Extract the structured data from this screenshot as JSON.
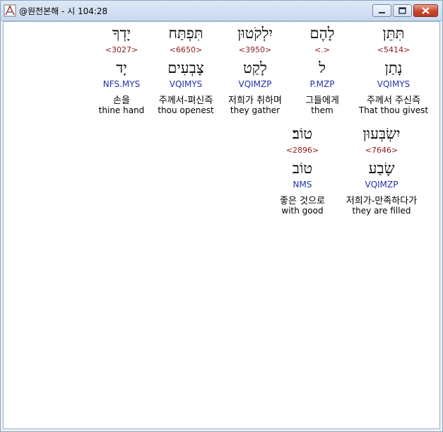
{
  "window": {
    "title": "@원전본해 - 시 104:28",
    "icon": "app-compass-icon",
    "controls": [
      "minimize-icon",
      "maximize-icon",
      "close-icon"
    ],
    "close_color": "#c9462c"
  },
  "colors": {
    "strong": "#8b1a1a",
    "morph": "#2233aa",
    "highlight_bg": "#ffffff",
    "content_bg": "#ffffff"
  },
  "words": [
    {
      "heb": "תִּתֵּן",
      "strong": "<5414>",
      "lemma": "נָתַן",
      "morph": "VQIMYS",
      "kor": "주께서 주신즉",
      "eng": "That thou givest",
      "highlighted": true
    },
    {
      "heb": "לָהֶם",
      "strong": "<.>",
      "lemma": "ל",
      "morph": "P.MZP",
      "kor": "그들에게",
      "eng": "them",
      "highlighted": false
    },
    {
      "heb": "יִלְקֹטוּן",
      "strong": "<3950>",
      "lemma": "לָקַט",
      "morph": "VQIMZP",
      "kor": "저희가 취하며",
      "eng": "they gather",
      "highlighted": false
    },
    {
      "heb": "תִּפְתַּח",
      "strong": "<6650>",
      "lemma": "צָבְעִים",
      "morph": "VQIMYS",
      "kor": "주께서-펴신즉",
      "eng": "thou openest",
      "highlighted": false
    },
    {
      "heb": "יָדְךָ",
      "strong": "<3027>",
      "lemma": "יָד",
      "morph": "NFS.MYS",
      "kor": "손을",
      "eng": "thine hand",
      "highlighted": false
    },
    {
      "heb": "יִשְׂבְּעוּן",
      "strong": "<7646>",
      "lemma": "שָׂבַע",
      "morph": "VQIMZP",
      "kor": "저희가-만족하다가",
      "eng": "they are filled",
      "highlighted": false
    },
    {
      "heb": "טוֹב׃",
      "strong": "<2896>",
      "lemma": "טוֹב",
      "morph": "NMS",
      "kor": "좋은 것으로",
      "eng": "with good",
      "highlighted": false
    }
  ]
}
